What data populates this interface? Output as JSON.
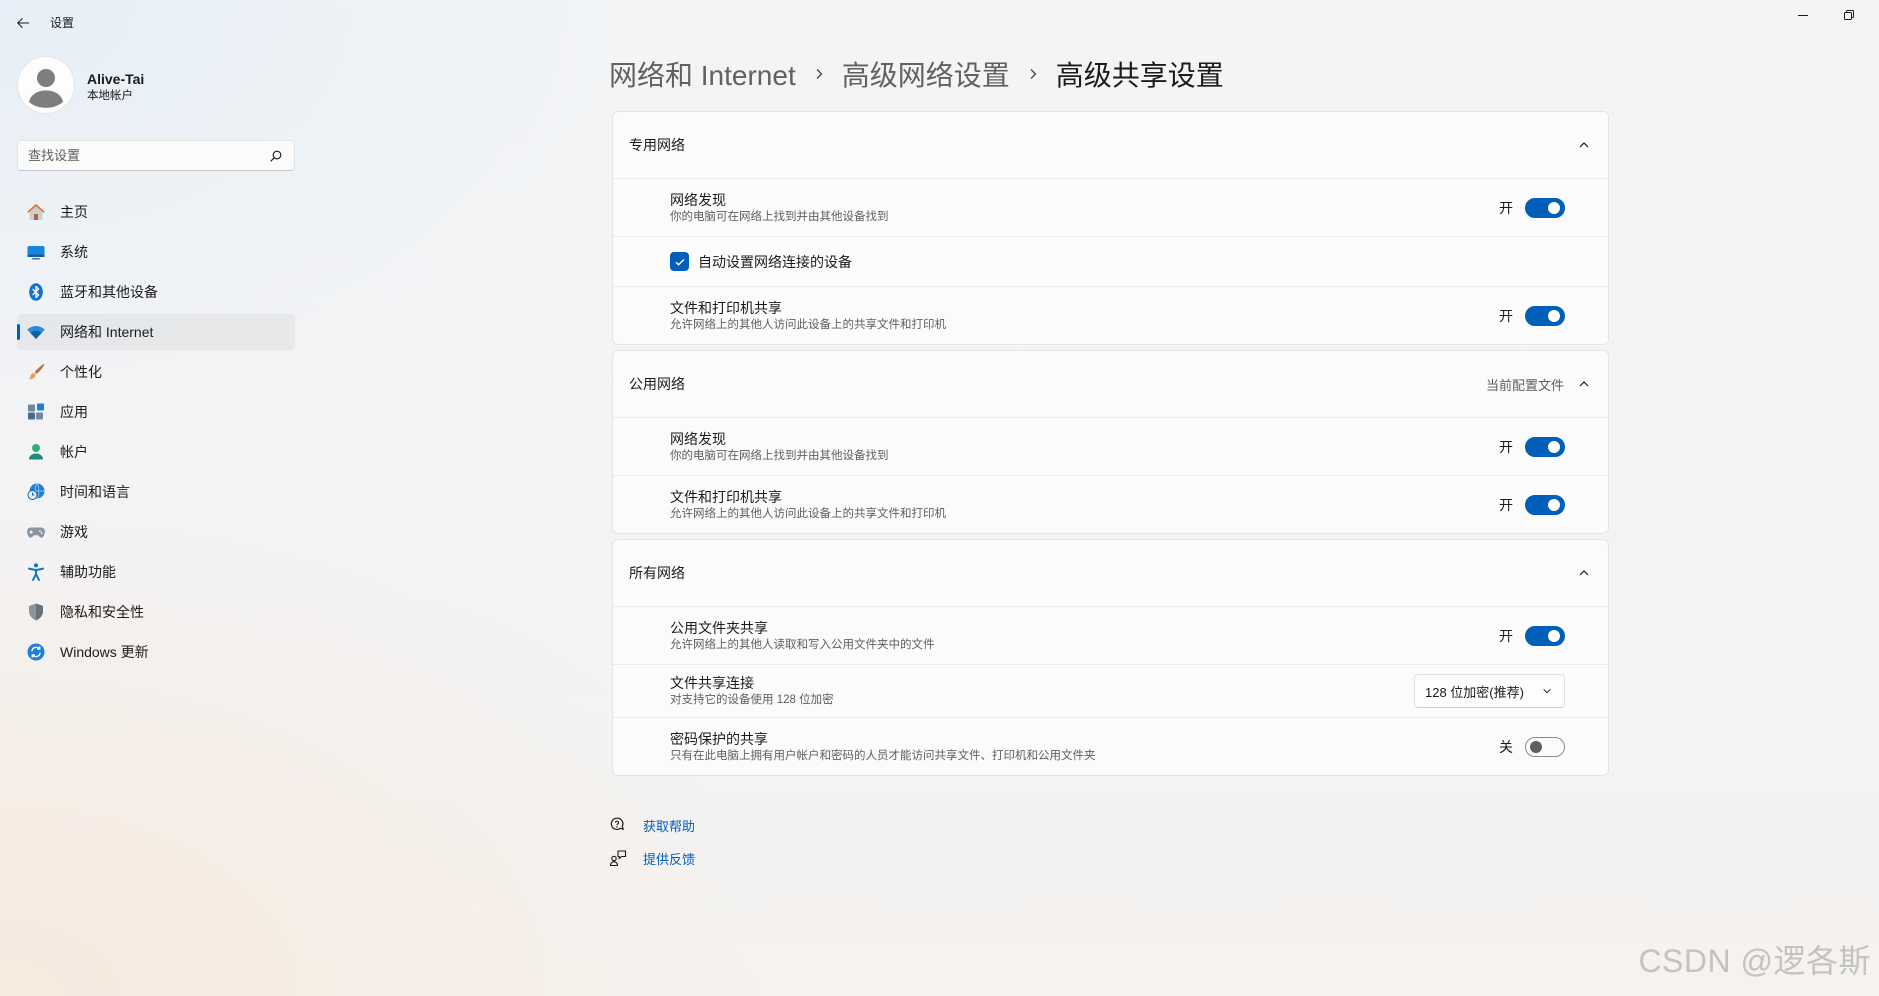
{
  "window": {
    "title": "设置",
    "back_icon": "back-arrow-icon",
    "controls": [
      "minimize-icon",
      "restore-icon"
    ]
  },
  "user": {
    "name": "Alive-Tai",
    "account_type": "本地帐户",
    "avatar_icon": "default-avatar-icon"
  },
  "search": {
    "placeholder": "查找设置",
    "icon": "search-icon"
  },
  "nav": {
    "items": [
      {
        "label": "主页",
        "icon": "home-icon",
        "selected": false
      },
      {
        "label": "系统",
        "icon": "system-monitor-icon",
        "selected": false
      },
      {
        "label": "蓝牙和其他设备",
        "icon": "bluetooth-icon",
        "selected": false
      },
      {
        "label": "网络和 Internet",
        "icon": "wifi-icon",
        "selected": true
      },
      {
        "label": "个性化",
        "icon": "brush-icon",
        "selected": false
      },
      {
        "label": "应用",
        "icon": "apps-icon",
        "selected": false
      },
      {
        "label": "帐户",
        "icon": "account-icon",
        "selected": false
      },
      {
        "label": "时间和语言",
        "icon": "globe-clock-icon",
        "selected": false
      },
      {
        "label": "游戏",
        "icon": "gamepad-icon",
        "selected": false
      },
      {
        "label": "辅助功能",
        "icon": "accessibility-icon",
        "selected": false
      },
      {
        "label": "隐私和安全性",
        "icon": "shield-icon",
        "selected": false
      },
      {
        "label": "Windows 更新",
        "icon": "update-icon",
        "selected": false
      }
    ]
  },
  "breadcrumb": [
    {
      "label": "网络和 Internet"
    },
    {
      "label": "高级网络设置"
    },
    {
      "label": "高级共享设置"
    }
  ],
  "sections": [
    {
      "title": "专用网络",
      "expanded": true,
      "rows": [
        {
          "title": "网络发现",
          "description": "你的电脑可在网络上找到并由其他设备找到",
          "state_label": "开",
          "on": true
        },
        {
          "label": "自动设置网络连接的设备",
          "checked": true
        },
        {
          "title": "文件和打印机共享",
          "description": "允许网络上的其他人访问此设备上的共享文件和打印机",
          "state_label": "开",
          "on": true
        }
      ]
    },
    {
      "title": "公用网络",
      "header_note": "当前配置文件",
      "expanded": true,
      "rows": [
        {
          "title": "网络发现",
          "description": "你的电脑可在网络上找到并由其他设备找到",
          "state_label": "开",
          "on": true
        },
        {
          "title": "文件和打印机共享",
          "description": "允许网络上的其他人访问此设备上的共享文件和打印机",
          "state_label": "开",
          "on": true
        }
      ]
    },
    {
      "title": "所有网络",
      "expanded": true,
      "rows": [
        {
          "title": "公用文件夹共享",
          "description": "允许网络上的其他人读取和写入公用文件夹中的文件",
          "state_label": "开",
          "on": true
        },
        {
          "title": "文件共享连接",
          "description": "对支持它的设备使用 128 位加密",
          "selected_option": "128 位加密(推荐)"
        },
        {
          "title": "密码保护的共享",
          "description": "只有在此电脑上拥有用户帐户和密码的人员才能访问共享文件、打印机和公用文件夹",
          "state_label": "关",
          "on": false
        }
      ]
    }
  ],
  "links": [
    {
      "label": "获取帮助",
      "icon": "get-help-icon"
    },
    {
      "label": "提供反馈",
      "icon": "feedback-icon"
    }
  ],
  "watermark": "CSDN @逻各斯",
  "colors": {
    "accent": "#005fb8",
    "link": "#005fb8",
    "text": "#1b1b1b",
    "secondary": "#5f5f5f"
  }
}
